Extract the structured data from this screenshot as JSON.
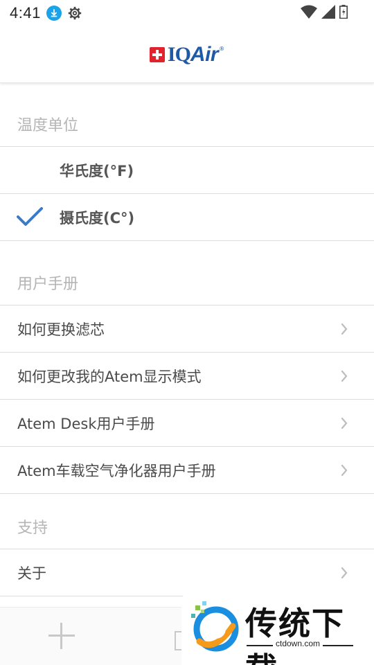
{
  "status_bar": {
    "time": "4:41"
  },
  "header": {
    "logo_text_iq": "IQ",
    "logo_text_air": "Air",
    "logo_reg": "®"
  },
  "sections": {
    "temperature": {
      "title": "温度单位",
      "options": [
        {
          "label": "华氏度(°F)",
          "selected": false
        },
        {
          "label": "摄氏度(C°)",
          "selected": true
        }
      ]
    },
    "manual": {
      "title": "用户手册",
      "items": [
        {
          "label": "如何更换滤芯"
        },
        {
          "label": "如何更改我的Atem显示模式"
        },
        {
          "label": "Atem Desk用户手册"
        },
        {
          "label": "Atem车载空气净化器用户手册"
        }
      ]
    },
    "support": {
      "title": "支持",
      "items": [
        {
          "label": "关于"
        }
      ]
    }
  },
  "watermark": {
    "title": "传统下载",
    "url": "ctdown.com"
  },
  "colors": {
    "accent": "#3a7bc8",
    "brand_blue": "#1f5aa6",
    "brand_red": "#e0232d"
  }
}
